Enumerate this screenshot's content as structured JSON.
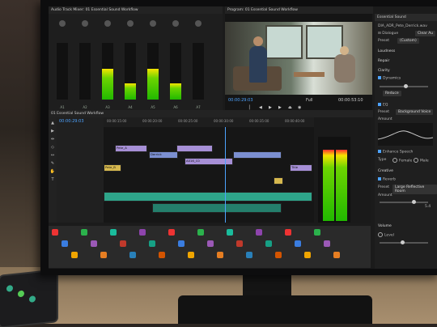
{
  "mixer": {
    "header": "Audio Track Mixer: 01 Essential Sound Workflow",
    "channels": [
      {
        "label": "A1",
        "level": 0.0
      },
      {
        "label": "A2",
        "level": 0.0
      },
      {
        "label": "A3",
        "level": 0.55
      },
      {
        "label": "A4",
        "level": 0.28
      },
      {
        "label": "A5",
        "level": 0.55
      },
      {
        "label": "A6",
        "level": 0.28
      },
      {
        "label": "A7",
        "level": 0.0
      }
    ]
  },
  "program": {
    "header": "Program: 01 Essential Sound Workflow",
    "timecode_in": "00:00:29:03",
    "timecode_out": "00:00:53:10",
    "zoom": "Full"
  },
  "essential": {
    "header": "Essential Sound",
    "clip_name": "DIA_ADR_Pete_Derrick.wav",
    "dialogue_label": "Dialogue",
    "clear_label": "Clear Au",
    "preset_label": "Preset",
    "preset_value": "(Custom)",
    "loudness_label": "Loudness",
    "repair_label": "Repair",
    "clarity_label": "Clarity",
    "dynamics_label": "Dynamics",
    "reduce_label": "Reduce",
    "eq_label": "EQ",
    "preset2_label": "Preset",
    "preset2_value": "Background Voice",
    "amount_label": "Amount",
    "enhance_label": "Enhance Speech",
    "type_label": "Type",
    "female_label": "Female",
    "male_label": "Male",
    "creative_label": "Creative",
    "reverb_label": "Reverb",
    "reverb_preset_label": "Preset",
    "reverb_preset_value": "Large Reflective Room",
    "reverb_amount_label": "Amount",
    "reverb_amount_value": "5.4",
    "volume_label": "Volume",
    "level_label": "Level"
  },
  "timeline": {
    "header": "01 Essential Sound Workflow",
    "timecode": "00:00:29:03",
    "ruler": [
      "00:00:15:00",
      "00:00:20:00",
      "00:00:25:00",
      "00:00:30:00",
      "00:00:35:00",
      "00:00:40:00"
    ],
    "clips": [
      {
        "label": "Pete_A",
        "kind": "v"
      },
      {
        "label": "Derrick",
        "kind": "vb"
      },
      {
        "label": "A016_C0",
        "kind": "v"
      },
      {
        "label": "Pete_B",
        "kind": "yel"
      },
      {
        "label": "Title",
        "kind": "v"
      }
    ]
  },
  "colors": {
    "accent": "#4da3ff",
    "meter_green": "#21b900",
    "meter_yellow": "#f6e400",
    "meter_red": "#ff3030"
  }
}
